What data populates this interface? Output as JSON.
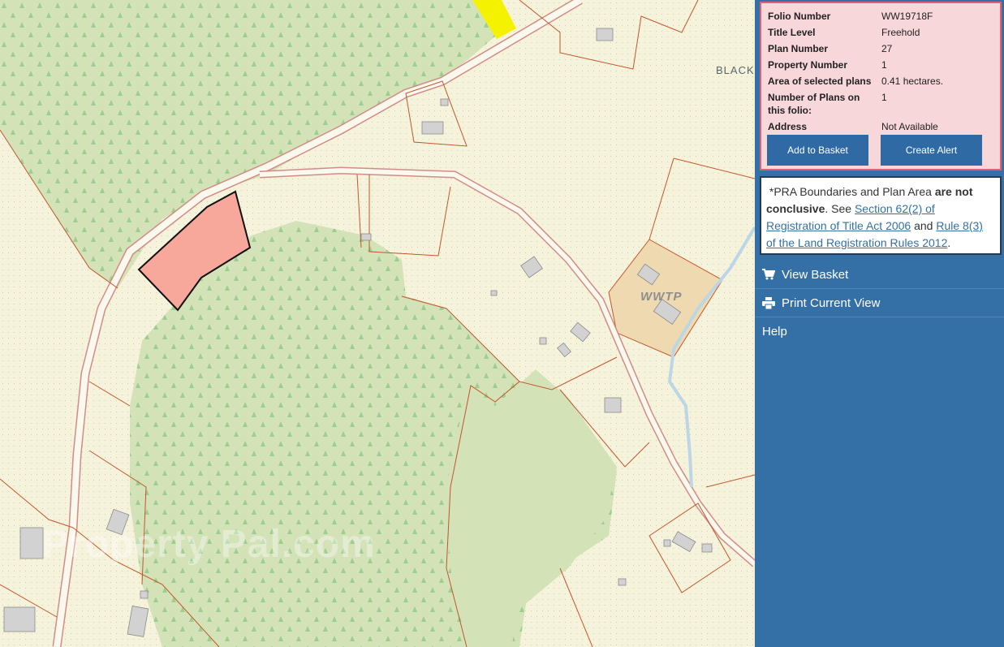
{
  "map": {
    "place_label": "BLACKR",
    "feature_label": "WWTP",
    "watermark": "Property Pal.com",
    "colors": {
      "background": "#f6f3dd",
      "forest": "#d4e2b8",
      "selected_plot": "#f8a89a",
      "boundary": "#c4562c",
      "wwtp_area": "#efd9b0",
      "highlight": "#f5f200",
      "stream": "#bcd6e6"
    }
  },
  "folio": {
    "rows": [
      {
        "label": "Folio Number",
        "value": "WW19718F"
      },
      {
        "label": "Title Level",
        "value": "Freehold"
      },
      {
        "label": "Plan Number",
        "value": "27"
      },
      {
        "label": "Property Number",
        "value": "1"
      },
      {
        "label": "Area of selected plans",
        "value": "0.41 hectares."
      },
      {
        "label": "Number of Plans on this folio:",
        "value": "1"
      },
      {
        "label": "Address",
        "value": "Not Available"
      }
    ],
    "add_to_basket": "Add to Basket",
    "create_alert": "Create Alert"
  },
  "notice": {
    "prefix": "*PRA Boundaries and Plan Area ",
    "bold": "are not conclusive",
    "middle": ". See ",
    "link1": "Section 62(2) of Registration of Title Act 2006",
    "and": " and ",
    "link2": "Rule 8(3) of the Land Registration Rules 2012",
    "suffix": "."
  },
  "menu": {
    "view_basket": "View Basket",
    "print_view": "Print Current View",
    "help": "Help"
  },
  "icons": {
    "basket": "shopping-cart-icon",
    "print": "printer-icon"
  }
}
